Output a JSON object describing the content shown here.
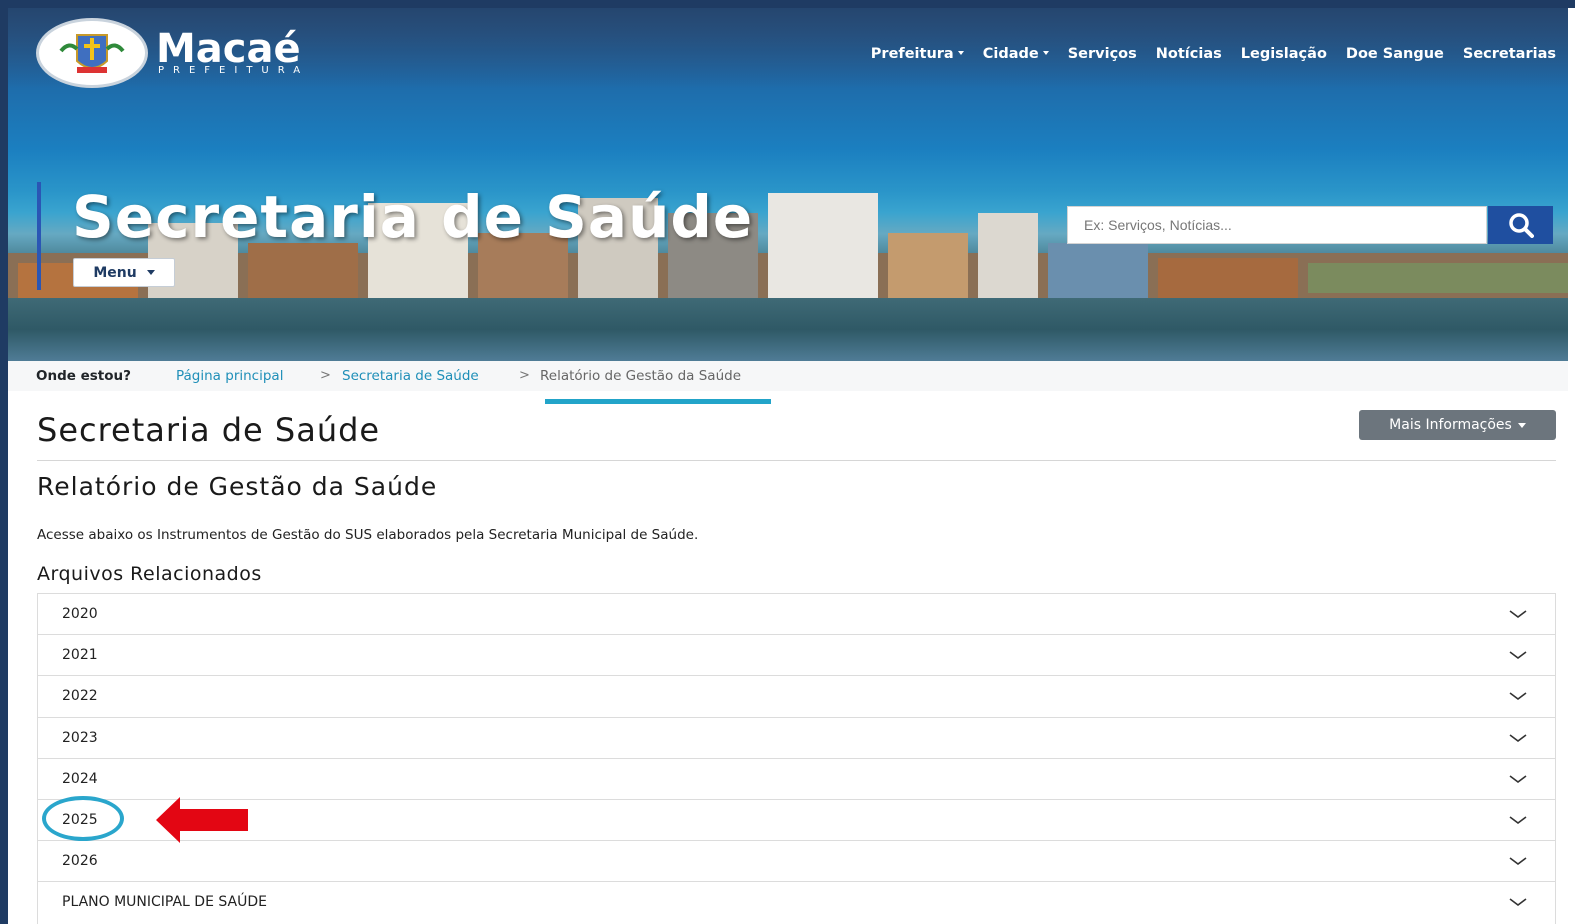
{
  "site": {
    "logo_name": "Macaé",
    "logo_sub": "PREFEITURA"
  },
  "nav": {
    "items": [
      "Prefeitura",
      "Cidade",
      "Serviços",
      "Notícias",
      "Legislação",
      "Doe Sangue",
      "Secretarias"
    ]
  },
  "hero": {
    "title": "Secretaria de Saúde",
    "menu_label": "Menu",
    "search_placeholder": "Ex: Serviços, Notícias..."
  },
  "breadcrumb": {
    "label": "Onde estou?",
    "items": [
      "Página principal",
      "Secretaria de Saúde"
    ],
    "separator": ">",
    "current": "Relatório de Gestão da Saúde"
  },
  "main": {
    "page_title": "Secretaria de Saúde",
    "more_info_label": "Mais Informações",
    "subtitle": "Relatório de Gestão da Saúde",
    "description": "Acesse abaixo os Instrumentos de Gestão do SUS elaborados pela Secretaria Municipal de Saúde.",
    "files_heading": "Arquivos Relacionados",
    "accordion": [
      "2020",
      "2021",
      "2022",
      "2023",
      "2024",
      "2025",
      "2026",
      "PLANO MUNICIPAL DE SAÚDE"
    ]
  },
  "annotation": {
    "highlighted_item": "2025",
    "circle_color": "#2aa6cc",
    "arrow_color": "#e30613"
  },
  "colors": {
    "frame": "#1f3b63",
    "search_button": "#1f4fa0",
    "link": "#1f8fb8",
    "accent_underline": "#22a4c9",
    "more_button": "#6c757d"
  }
}
